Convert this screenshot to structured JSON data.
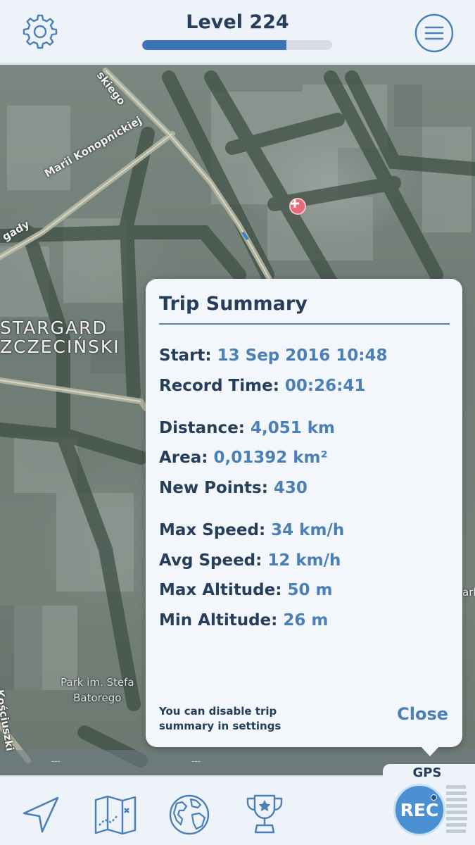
{
  "header": {
    "level_label": "Level 224",
    "progress_fraction": 0.76,
    "settings_icon": "gear-icon",
    "menu_icon": "hamburger-menu-icon"
  },
  "map": {
    "street_labels": [
      "Marii Konopnickiej",
      "skiego",
      "gady",
      "Kościuszki"
    ],
    "city_label_line1": "STARGARD",
    "city_label_line2": "ZCZECIŃSKI",
    "park_label_line1": "Park im. Stefa",
    "park_label_line2": "Batorego",
    "edge_label": "ark",
    "poi_icon": "hospital-cross-icon",
    "scale_marks": [
      "---",
      "---"
    ]
  },
  "trip_summary": {
    "title": "Trip Summary",
    "start_label": "Start:",
    "start_value": "13 Sep 2016 10:48",
    "record_time_label": "Record Time:",
    "record_time_value": "00:26:41",
    "distance_label": "Distance:",
    "distance_value": "4,051 km",
    "area_label": "Area:",
    "area_value": "0,01392 km²",
    "new_points_label": "New Points:",
    "new_points_value": "430",
    "max_speed_label": "Max Speed:",
    "max_speed_value": "34 km/h",
    "avg_speed_label": "Avg Speed:",
    "avg_speed_value": "12 km/h",
    "max_altitude_label": "Max Altitude:",
    "max_altitude_value": "50 m",
    "min_altitude_label": "Min Altitude:",
    "min_altitude_value": "26 m",
    "hint_line1": "You can disable trip",
    "hint_line2": "summary in settings",
    "close_label": "Close"
  },
  "bottom_nav": {
    "items": [
      "navigation-arrow-icon",
      "map-icon",
      "globe-icon",
      "trophy-icon"
    ],
    "gps_label": "GPS",
    "rec_label": "REC"
  },
  "colors": {
    "accent": "#4a7fb8",
    "dark_text": "#253e5c",
    "bar_bg": "#edf3f9",
    "rec_button": "#4a90d2"
  }
}
